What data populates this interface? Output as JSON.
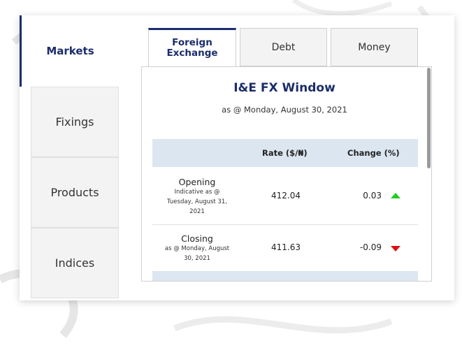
{
  "nav": {
    "markets_label": "Markets",
    "side_items": [
      {
        "label": "Fixings"
      },
      {
        "label": "Products"
      },
      {
        "label": "Indices"
      }
    ]
  },
  "tabs": {
    "fx_line1": "Foreign",
    "fx_line2": "Exchange",
    "debt": "Debt",
    "money": "Money"
  },
  "fx_window": {
    "title": "I&E FX Window",
    "date": "as @ Monday, August 30, 2021",
    "headers": {
      "rate": "Rate ($/₦)",
      "change": "Change (%)"
    },
    "rows": [
      {
        "label": "Opening",
        "sub_lines": [
          "Indicative as @",
          "Tuesday, August 31,",
          "2021"
        ],
        "rate": "412.04",
        "change": "0.03",
        "direction": "up"
      },
      {
        "label": "Closing",
        "sub_lines": [
          "as @ Monday, August",
          "30, 2021"
        ],
        "rate": "411.63",
        "change": "-0.09",
        "direction": "down"
      }
    ]
  },
  "colors": {
    "accent": "#1b2d6b",
    "header_bg": "#dce6f1",
    "up": "#22cc22",
    "down": "#dd1111"
  }
}
